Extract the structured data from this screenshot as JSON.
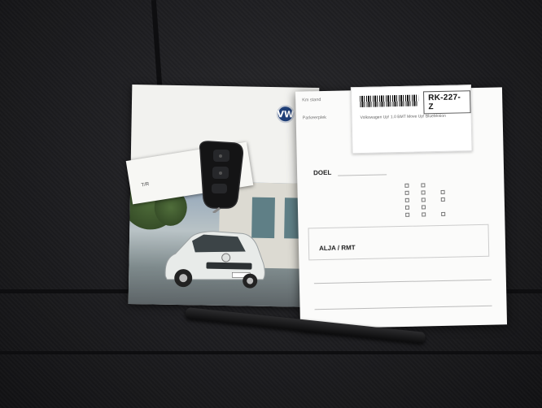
{
  "booklet": {
    "logo_icon": "vw-logo-icon",
    "tag_code": "T/R"
  },
  "checklist": {
    "plate": "RK-227-Z",
    "sticker_lines": [
      "Volkswagen Up! 1.0 BMT Move Up! BlueMotion",
      "",
      "",
      "",
      ""
    ],
    "doel": "DOEL",
    "alja_label": "ALJA / RMT"
  },
  "colors": {
    "seat": "#1d1d20",
    "paper": "#fbfbfa",
    "car": "#e8ebe9"
  }
}
